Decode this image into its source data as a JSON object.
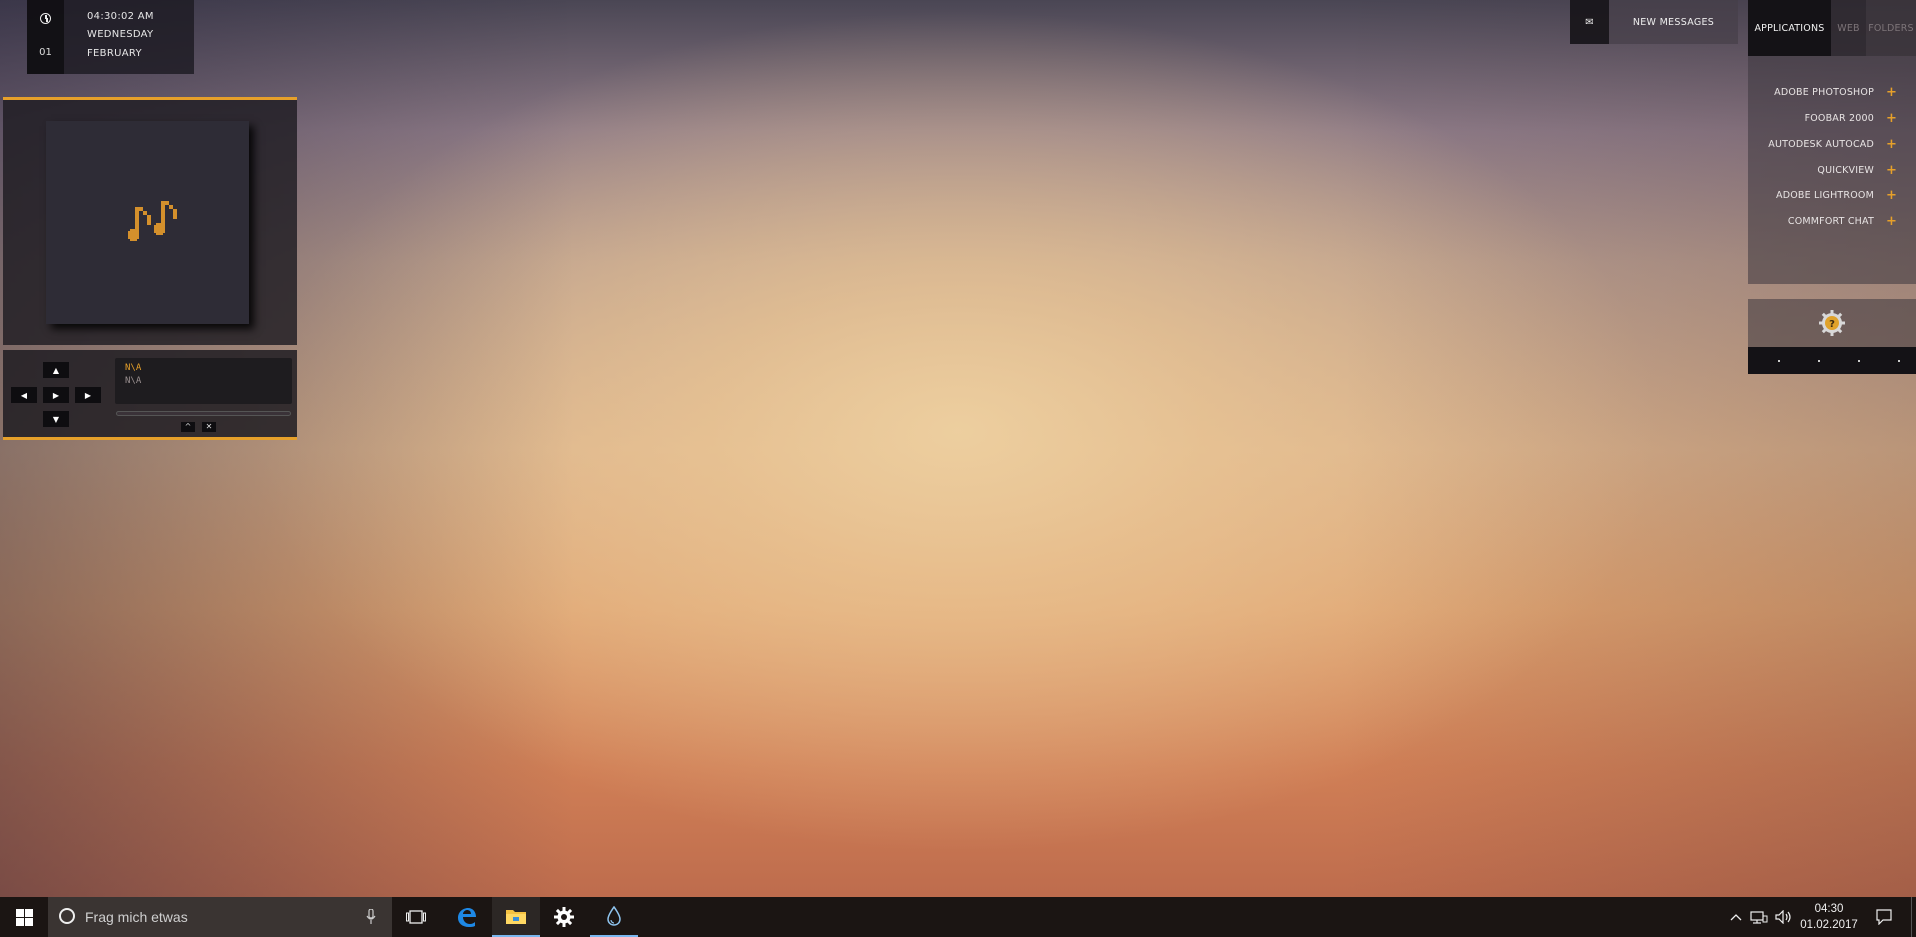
{
  "clock": {
    "time": "04:30:02 AM",
    "weekday": "WEDNESDAY",
    "day": "01",
    "month": "FEBRUARY"
  },
  "player": {
    "artist": "N\\A",
    "title": "N\\A",
    "progress": 0,
    "controls": {
      "up": "▲",
      "down": "▼",
      "prev": "◀",
      "play": "▶",
      "next": "▶",
      "minimize": "^",
      "close": "✕"
    }
  },
  "messages": {
    "label": "NEW MESSAGES",
    "icon": "envelope-icon"
  },
  "launcher": {
    "tabs": [
      {
        "label": "APPLICATIONS",
        "active": true
      },
      {
        "label": "WEB",
        "active": false
      },
      {
        "label": "FOLDERS",
        "active": false
      }
    ],
    "apps": [
      {
        "label": "ADOBE PHOTOSHOP"
      },
      {
        "label": "FOOBAR 2000"
      },
      {
        "label": "AUTODESK AUTOCAD"
      },
      {
        "label": "QUICKVIEW"
      },
      {
        "label": "ADOBE LIGHTROOM"
      },
      {
        "label": "COMMFORT CHAT"
      }
    ],
    "plus": "+"
  },
  "taskbar": {
    "search_placeholder": "Frag mich etwas",
    "time": "04:30",
    "date": "01.02.2017",
    "icons": [
      "windows-start-icon",
      "cortana-icon",
      "microphone-icon",
      "task-view-icon",
      "edge-icon",
      "file-explorer-icon",
      "settings-icon",
      "rainmeter-icon"
    ]
  },
  "colors": {
    "accent": "#e6a02a",
    "panel": "#1c1a20",
    "taskbar": "#1b1513"
  }
}
